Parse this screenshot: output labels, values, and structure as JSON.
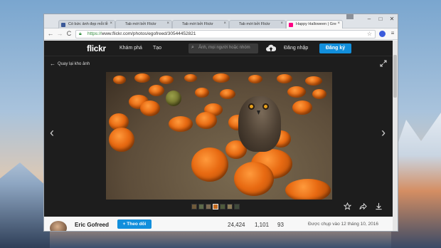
{
  "browser": {
    "tabs": [
      {
        "label": "Có bức ảnh đẹp mỗi lễ",
        "favicon_color": "#3b5998",
        "active": false
      },
      {
        "label": "Tab mới bởi Flickr",
        "favicon_color": "",
        "active": false
      },
      {
        "label": "Tab mới bởi Flickr",
        "favicon_color": "",
        "active": false
      },
      {
        "label": "Tab mới bởi Flickr",
        "favicon_color": "",
        "active": false
      },
      {
        "label": "Happy Halloween | Gre",
        "favicon_color": "#ff0084",
        "active": true
      }
    ],
    "close_glyph": "×",
    "window_controls": {
      "minimize": "–",
      "maximize": "□",
      "close": "✕"
    },
    "nav": {
      "back": "←",
      "forward": "→",
      "reload": "C"
    },
    "url": {
      "secure_prefix": "https://",
      "rest": "www.flickr.com/photos/egofreed/30544452821"
    },
    "star_glyph": "☆",
    "menu_glyph": "≡"
  },
  "flickr": {
    "logo": "flickr",
    "nav_links": [
      "Khám phá",
      "Tạo"
    ],
    "search_placeholder": "Ảnh, mọi người hoặc nhóm",
    "login": "Đăng nhập",
    "signup": "Đăng ký",
    "back_label": "Quay lại kho ảnh",
    "owner_name": "Eric Gofreed",
    "follow_label": "+ Theo dõi",
    "stats": [
      "24,424",
      "1,101",
      "93"
    ],
    "taken": "Được chụp vào 12 tháng 10, 2016",
    "prev_glyph": "‹",
    "next_glyph": "›",
    "accent": "#128fdc"
  }
}
